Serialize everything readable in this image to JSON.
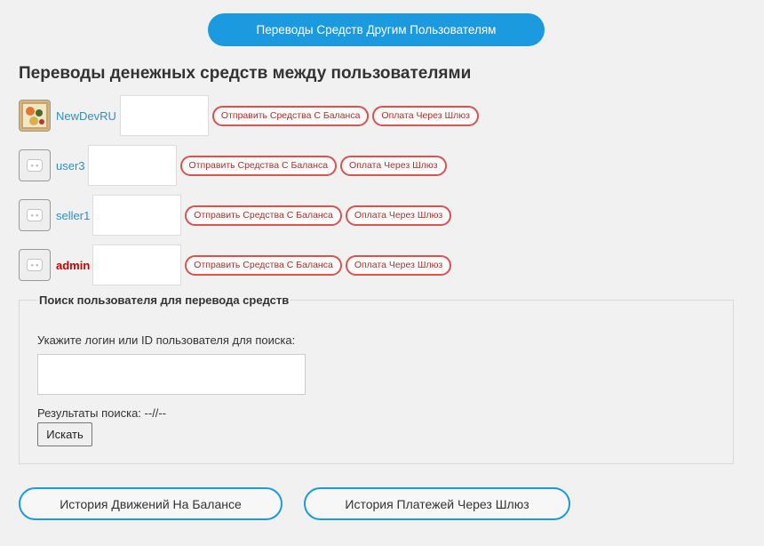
{
  "header": {
    "top_button_label": "Переводы Средств Другим Пользователям"
  },
  "main": {
    "title": "Переводы денежных средств между пользователями"
  },
  "users": [
    {
      "name": "NewDevRU",
      "avatar": "photo-avatar"
    },
    {
      "name": "user3",
      "avatar": "default-avatar-icon"
    },
    {
      "name": "seller1",
      "avatar": "default-avatar-icon"
    },
    {
      "name": "admin",
      "avatar": "default-avatar-icon"
    }
  ],
  "actions": {
    "send_from_balance": "Отправить Средства С Баланса",
    "pay_via_gateway": "Оплата Через Шлюз"
  },
  "search": {
    "legend": "Поиск пользователя для перевода средств",
    "label": "Укажите логин или ID пользователя для поиска:",
    "input_value": "",
    "results_text": "Результаты поиска: --//--",
    "button_label": "Искать"
  },
  "footer": {
    "balance_history_label": "История Движений На Балансе",
    "gateway_history_label": "История Платежей Через Шлюз"
  },
  "colors": {
    "accent": "#1b9ae0",
    "link": "#2f8fc7",
    "admin": "#cc0000",
    "pill_border": "#d9534f",
    "background": "#f1f1f1"
  }
}
